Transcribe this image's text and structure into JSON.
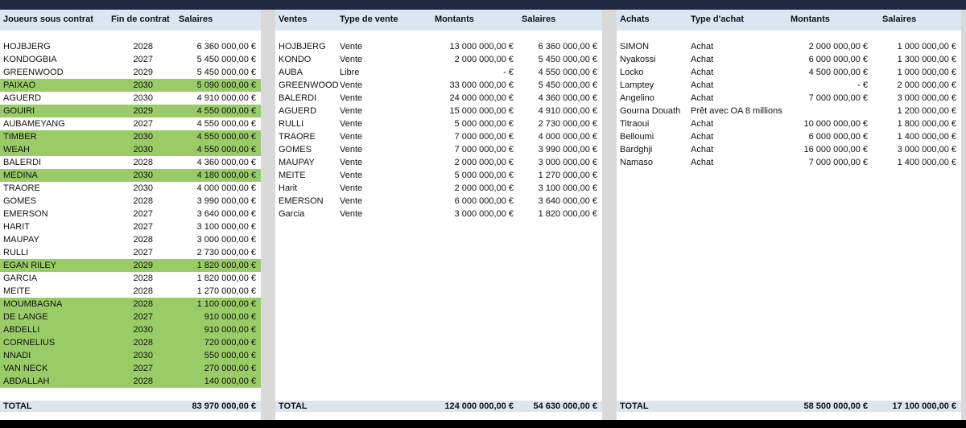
{
  "contrats": {
    "headers": [
      "Joueurs sous contrat",
      "Fin de contrat",
      "Salaires"
    ],
    "rows": [
      {
        "name": "HOJBJERG",
        "end": "2028",
        "salary": "6 360 000,00 €",
        "green": false
      },
      {
        "name": "KONDOGBIA",
        "end": "2027",
        "salary": "5 450 000,00 €",
        "green": false
      },
      {
        "name": "GREENWOOD",
        "end": "2029",
        "salary": "5 450 000,00 €",
        "green": false
      },
      {
        "name": "PAIXAO",
        "end": "2030",
        "salary": "5 090 000,00 €",
        "green": true
      },
      {
        "name": "AGUERD",
        "end": "2030",
        "salary": "4 910 000,00 €",
        "green": false
      },
      {
        "name": "GOUIRI",
        "end": "2029",
        "salary": "4 550 000,00 €",
        "green": true
      },
      {
        "name": "AUBAMEYANG",
        "end": "2027",
        "salary": "4 550 000,00 €",
        "green": false
      },
      {
        "name": "TIMBER",
        "end": "2030",
        "salary": "4 550 000,00 €",
        "green": true
      },
      {
        "name": "WEAH",
        "end": "2030",
        "salary": "4 550 000,00 €",
        "green": true
      },
      {
        "name": "BALERDI",
        "end": "2028",
        "salary": "4 360 000,00 €",
        "green": false
      },
      {
        "name": "MEDINA",
        "end": "2030",
        "salary": "4 180 000,00 €",
        "green": true
      },
      {
        "name": "TRAORE",
        "end": "2030",
        "salary": "4 000 000,00 €",
        "green": false
      },
      {
        "name": "GOMES",
        "end": "2028",
        "salary": "3 990 000,00 €",
        "green": false
      },
      {
        "name": "EMERSON",
        "end": "2027",
        "salary": "3 640 000,00 €",
        "green": false
      },
      {
        "name": "HARIT",
        "end": "2027",
        "salary": "3 100 000,00 €",
        "green": false
      },
      {
        "name": "MAUPAY",
        "end": "2028",
        "salary": "3 000 000,00 €",
        "green": false
      },
      {
        "name": "RULLI",
        "end": "2027",
        "salary": "2 730 000,00 €",
        "green": false
      },
      {
        "name": "EGAN RILEY",
        "end": "2029",
        "salary": "1 820 000,00 €",
        "green": true
      },
      {
        "name": "GARCIA",
        "end": "2028",
        "salary": "1 820 000,00 €",
        "green": false
      },
      {
        "name": "MEITE",
        "end": "2028",
        "salary": "1 270 000,00 €",
        "green": false
      },
      {
        "name": "MOUMBAGNA",
        "end": "2028",
        "salary": "1 100 000,00 €",
        "green": true
      },
      {
        "name": "DE LANGE",
        "end": "2027",
        "salary": "910 000,00 €",
        "green": true
      },
      {
        "name": "ABDELLI",
        "end": "2030",
        "salary": "910 000,00 €",
        "green": true
      },
      {
        "name": "CORNELIUS",
        "end": "2028",
        "salary": "720 000,00 €",
        "green": true
      },
      {
        "name": "NNADI",
        "end": "2030",
        "salary": "550 000,00 €",
        "green": true
      },
      {
        "name": "VAN NECK",
        "end": "2027",
        "salary": "270 000,00 €",
        "green": true
      },
      {
        "name": "ABDALLAH",
        "end": "2028",
        "salary": "140 000,00 €",
        "green": true
      }
    ],
    "total_label": "TOTAL",
    "total_salary": "83 970 000,00 €"
  },
  "ventes": {
    "headers": [
      "Ventes",
      "Type de vente",
      "Montants",
      "Salaires"
    ],
    "rows": [
      {
        "name": "HOJBJERG",
        "type": "Vente",
        "amount": "13 000 000,00 €",
        "salary": "6 360 000,00 €"
      },
      {
        "name": "KONDO",
        "type": "Vente",
        "amount": "2 000 000,00 €",
        "salary": "5 450 000,00 €"
      },
      {
        "name": "AUBA",
        "type": "Libre",
        "amount": "-     €",
        "salary": "4 550 000,00 €"
      },
      {
        "name": "GREENWOOD",
        "type": "Vente",
        "amount": "33 000 000,00 €",
        "salary": "5 450 000,00 €"
      },
      {
        "name": "BALERDI",
        "type": "Vente",
        "amount": "24 000 000,00 €",
        "salary": "4 360 000,00 €"
      },
      {
        "name": "AGUERD",
        "type": "Vente",
        "amount": "15 000 000,00 €",
        "salary": "4 910 000,00 €"
      },
      {
        "name": "RULLI",
        "type": "Vente",
        "amount": "5 000 000,00 €",
        "salary": "2 730 000,00 €"
      },
      {
        "name": "TRAORE",
        "type": "Vente",
        "amount": "7 000 000,00 €",
        "salary": "4 000 000,00 €"
      },
      {
        "name": "GOMES",
        "type": "Vente",
        "amount": "7 000 000,00 €",
        "salary": "3 990 000,00 €"
      },
      {
        "name": "MAUPAY",
        "type": "Vente",
        "amount": "2 000 000,00 €",
        "salary": "3 000 000,00 €"
      },
      {
        "name": "MEITE",
        "type": "Vente",
        "amount": "5 000 000,00 €",
        "salary": "1 270 000,00 €"
      },
      {
        "name": "Harit",
        "type": "Vente",
        "amount": "2 000 000,00 €",
        "salary": "3 100 000,00 €"
      },
      {
        "name": "EMERSON",
        "type": "Vente",
        "amount": "6 000 000,00 €",
        "salary": "3 640 000,00 €"
      },
      {
        "name": "Garcia",
        "type": "Vente",
        "amount": "3 000 000,00 €",
        "salary": "1 820 000,00 €"
      }
    ],
    "total_label": "TOTAL",
    "total_amount": "124 000 000,00 €",
    "total_salary": "54 630 000,00 €"
  },
  "achats": {
    "headers": [
      "Achats",
      "Type d'achat",
      "Montants",
      "Salaires"
    ],
    "rows": [
      {
        "name": "SIMON",
        "type": "Achat",
        "amount": "2 000 000,00 €",
        "salary": "1 000 000,00 €"
      },
      {
        "name": "Nyakossi",
        "type": "Achat",
        "amount": "6 000 000,00 €",
        "salary": "1 300 000,00 €"
      },
      {
        "name": "Locko",
        "type": "Achat",
        "amount": "4 500 000,00 €",
        "salary": "1 000 000,00 €"
      },
      {
        "name": "Lamptey",
        "type": "Achat",
        "amount": "-     €",
        "salary": "2 000 000,00 €"
      },
      {
        "name": "Angelino",
        "type": "Achat",
        "amount": "7 000 000,00 €",
        "salary": "3 000 000,00 €"
      },
      {
        "name": "Gourna Douath",
        "type": "Prêt avec OA 8 millions",
        "amount": "",
        "salary": "1 200 000,00 €"
      },
      {
        "name": "Titraoui",
        "type": "Achat",
        "amount": "10 000 000,00 €",
        "salary": "1 800 000,00 €"
      },
      {
        "name": "Belloumi",
        "type": "Achat",
        "amount": "6 000 000,00 €",
        "salary": "1 400 000,00 €"
      },
      {
        "name": "Bardghji",
        "type": "Achat",
        "amount": "16 000 000,00 €",
        "salary": "3 000 000,00 €"
      },
      {
        "name": "Namaso",
        "type": "Achat",
        "amount": "7 000 000,00 €",
        "salary": "1 400 000,00 €"
      }
    ],
    "total_label": "TOTAL",
    "total_amount": "58 500 000,00 €",
    "total_salary": "17 100 000,00 €"
  }
}
